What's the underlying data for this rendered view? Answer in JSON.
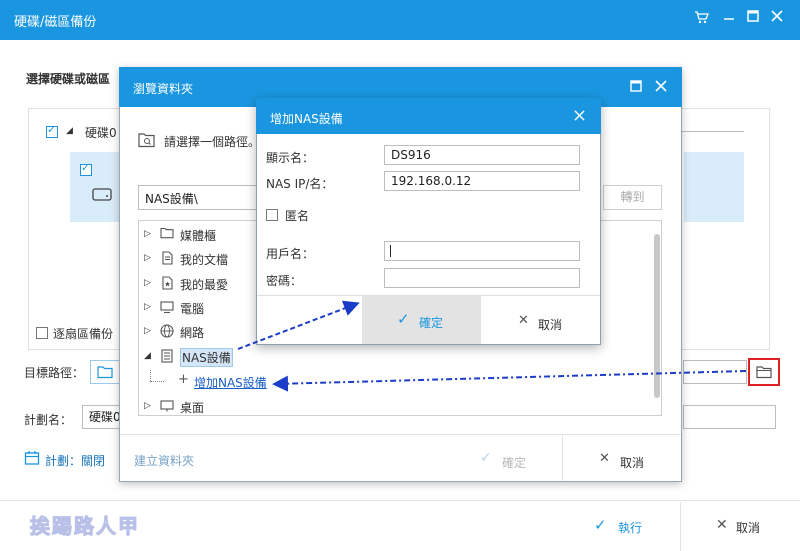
{
  "main": {
    "title": "硬碟/磁區備份",
    "section_title": "選擇硬碟或磁區",
    "disk_label": "硬碟0",
    "sector_backup": "逐扇區備份",
    "target_path_label": "目標路徑：",
    "plan_name_label": "計劃名：",
    "plan_name_value": "硬碟0",
    "schedule_label": "計劃：關閉",
    "execute": "執行",
    "cancel": "取消",
    "watermark": "挨踢路人甲"
  },
  "browse": {
    "title": "瀏覽資料夾",
    "prompt": "請選擇一個路徑。",
    "path_value": "NAS設備\\",
    "goto": "轉到",
    "tree": [
      {
        "label": "媒體櫃",
        "icon": "folder-icon"
      },
      {
        "label": "我的文檔",
        "icon": "document-icon"
      },
      {
        "label": "我的最愛",
        "icon": "favorites-icon"
      },
      {
        "label": "電腦",
        "icon": "computer-icon"
      },
      {
        "label": "網路",
        "icon": "network-icon"
      },
      {
        "label": "NAS設備",
        "icon": "nas-icon"
      },
      {
        "label": "增加NAS設備",
        "icon": "plus-icon"
      },
      {
        "label": "桌面",
        "icon": "desktop-icon"
      }
    ],
    "new_folder": "建立資料夾",
    "ok": "確定",
    "cancel": "取消"
  },
  "nas": {
    "title": "增加NAS設備",
    "display_name_label": "顯示名：",
    "display_name_value": "DS916",
    "ip_label": "NAS IP/名：",
    "ip_value": "192.168.0.12",
    "anonymous_label": "匿名",
    "user_label": "用戶名：",
    "user_value": "",
    "password_label": "密碼：",
    "password_value": "",
    "ok": "確定",
    "cancel": "取消"
  },
  "colors": {
    "accent": "#1a96e0",
    "highlight": "#d9ecfa",
    "annotation": "#1a3cc8",
    "annotation_box": "#e02020"
  }
}
